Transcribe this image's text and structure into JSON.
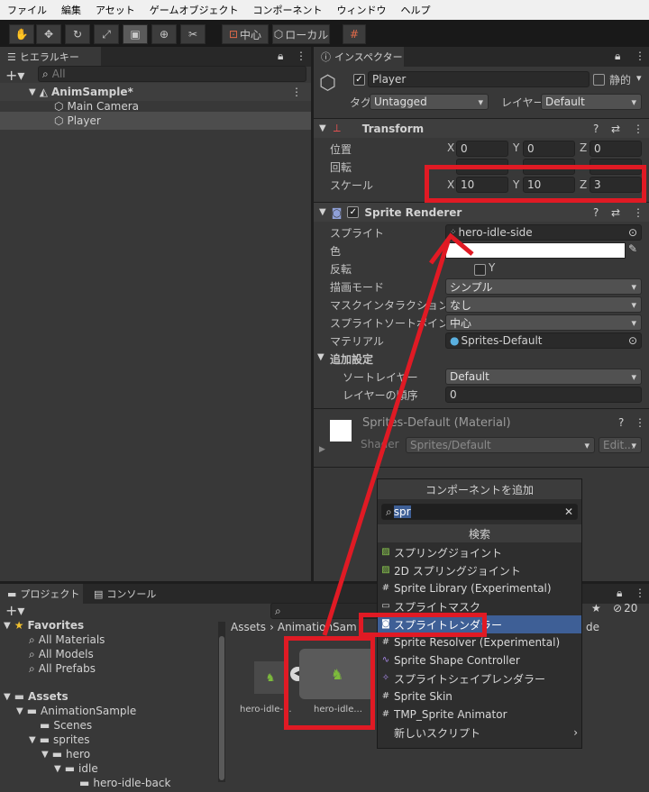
{
  "menu": [
    "ファイル",
    "編集",
    "アセット",
    "ゲームオブジェクト",
    "コンポーネント",
    "ウィンドウ",
    "ヘルプ"
  ],
  "toolbar": {
    "pivot": "中心",
    "space": "ローカル"
  },
  "hierarchy": {
    "tab": "ヒエラルキー",
    "search_placeholder": "All",
    "scene": "AnimSample*",
    "items": [
      "Main Camera",
      "Player"
    ]
  },
  "inspector": {
    "tab": "インスペクター",
    "object_name": "Player",
    "static_label": "静的",
    "tag_label": "タグ",
    "tag_value": "Untagged",
    "layer_label": "レイヤー",
    "layer_value": "Default",
    "transform": {
      "title": "Transform",
      "position_label": "位置",
      "rotation_label": "回転",
      "scale_label": "スケール",
      "position": {
        "x": "0",
        "y": "0",
        "z": "0"
      },
      "scale": {
        "x": "10",
        "y": "10",
        "z": "3"
      }
    },
    "sprite_renderer": {
      "title": "Sprite Renderer",
      "sprite_label": "スプライト",
      "sprite_value": "hero-idle-side",
      "color_label": "色",
      "flip_label": "反転",
      "flip_y": "Y",
      "draw_mode_label": "描画モード",
      "draw_mode_value": "シンプル",
      "mask_label": "マスクインタラクション",
      "mask_value": "なし",
      "sort_point_label": "スプライトソートポイント",
      "sort_point_value": "中心",
      "material_label": "マテリアル",
      "material_value": "Sprites-Default",
      "additional_label": "追加設定",
      "sorting_layer_label": "ソートレイヤー",
      "sorting_layer_value": "Default",
      "order_label": "レイヤーの順序",
      "order_value": "0"
    },
    "material": {
      "name": "Sprites-Default (Material)",
      "shader_label": "Shader",
      "shader_value": "Sprites/Default",
      "edit_label": "Edit..."
    }
  },
  "add_component": {
    "title": "コンポーネントを追加",
    "search_value": "spr",
    "section": "検索",
    "items": [
      {
        "label": "スプリングジョイント",
        "icon": "spring-joint-icon"
      },
      {
        "label": "2D スプリングジョイント",
        "icon": "spring-joint-2d-icon"
      },
      {
        "label": "Sprite Library (Experimental)",
        "icon": "script-icon"
      },
      {
        "label": "スプライトマスク",
        "icon": "sprite-mask-icon"
      },
      {
        "label": "スプライトレンダラー",
        "icon": "sprite-renderer-icon"
      },
      {
        "label": "Sprite Resolver (Experimental)",
        "icon": "script-icon"
      },
      {
        "label": "Sprite Shape Controller",
        "icon": "sprite-shape-icon"
      },
      {
        "label": "スプライトシェイプレンダラー",
        "icon": "sprite-shape-renderer-icon"
      },
      {
        "label": "Sprite Skin",
        "icon": "script-icon"
      },
      {
        "label": "TMP_Sprite Animator",
        "icon": "script-icon"
      },
      {
        "label": "新しいスクリプト",
        "icon": ""
      }
    ]
  },
  "project": {
    "tab": "プロジェクト",
    "console_tab": "コンソール",
    "hidden_count": "20",
    "favorites_label": "Favorites",
    "favorites": [
      "All Materials",
      "All Models",
      "All Prefabs"
    ],
    "assets_label": "Assets",
    "tree": [
      "AnimationSample",
      "Scenes",
      "sprites",
      "hero",
      "idle",
      "hero-idle-back"
    ],
    "breadcrumb_root": "Assets",
    "breadcrumb_child": "AnimationSam",
    "breadcrumb_tail": "de",
    "assets": [
      "hero-idle-...",
      "hero-idle..."
    ]
  },
  "colors": {
    "highlight": "#3e5f96",
    "annotation": "#e01a24"
  }
}
